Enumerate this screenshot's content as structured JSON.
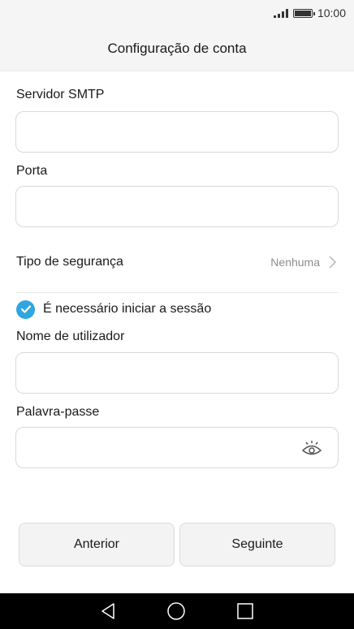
{
  "status_bar": {
    "time": "10:00"
  },
  "header": {
    "title": "Configuração de conta"
  },
  "form": {
    "smtp_server": {
      "label": "Servidor SMTP",
      "value": ""
    },
    "port": {
      "label": "Porta",
      "value": ""
    },
    "security_type": {
      "label": "Tipo de segurança",
      "value": "Nenhuma"
    },
    "login_required": {
      "label": "É necessário iniciar a sessão",
      "checked": true
    },
    "username": {
      "label": "Nome de utilizador",
      "value": ""
    },
    "password": {
      "label": "Palavra-passe",
      "value": ""
    }
  },
  "buttons": {
    "previous": "Anterior",
    "next": "Seguinte"
  },
  "colors": {
    "accent": "#2fa6dd",
    "header_bg": "#f5f5f5",
    "nav_bg": "#000000"
  },
  "icons": [
    "signal-icon",
    "battery-icon",
    "chevron-right-icon",
    "check-icon",
    "eye-icon",
    "back-icon",
    "home-icon",
    "recents-icon"
  ]
}
